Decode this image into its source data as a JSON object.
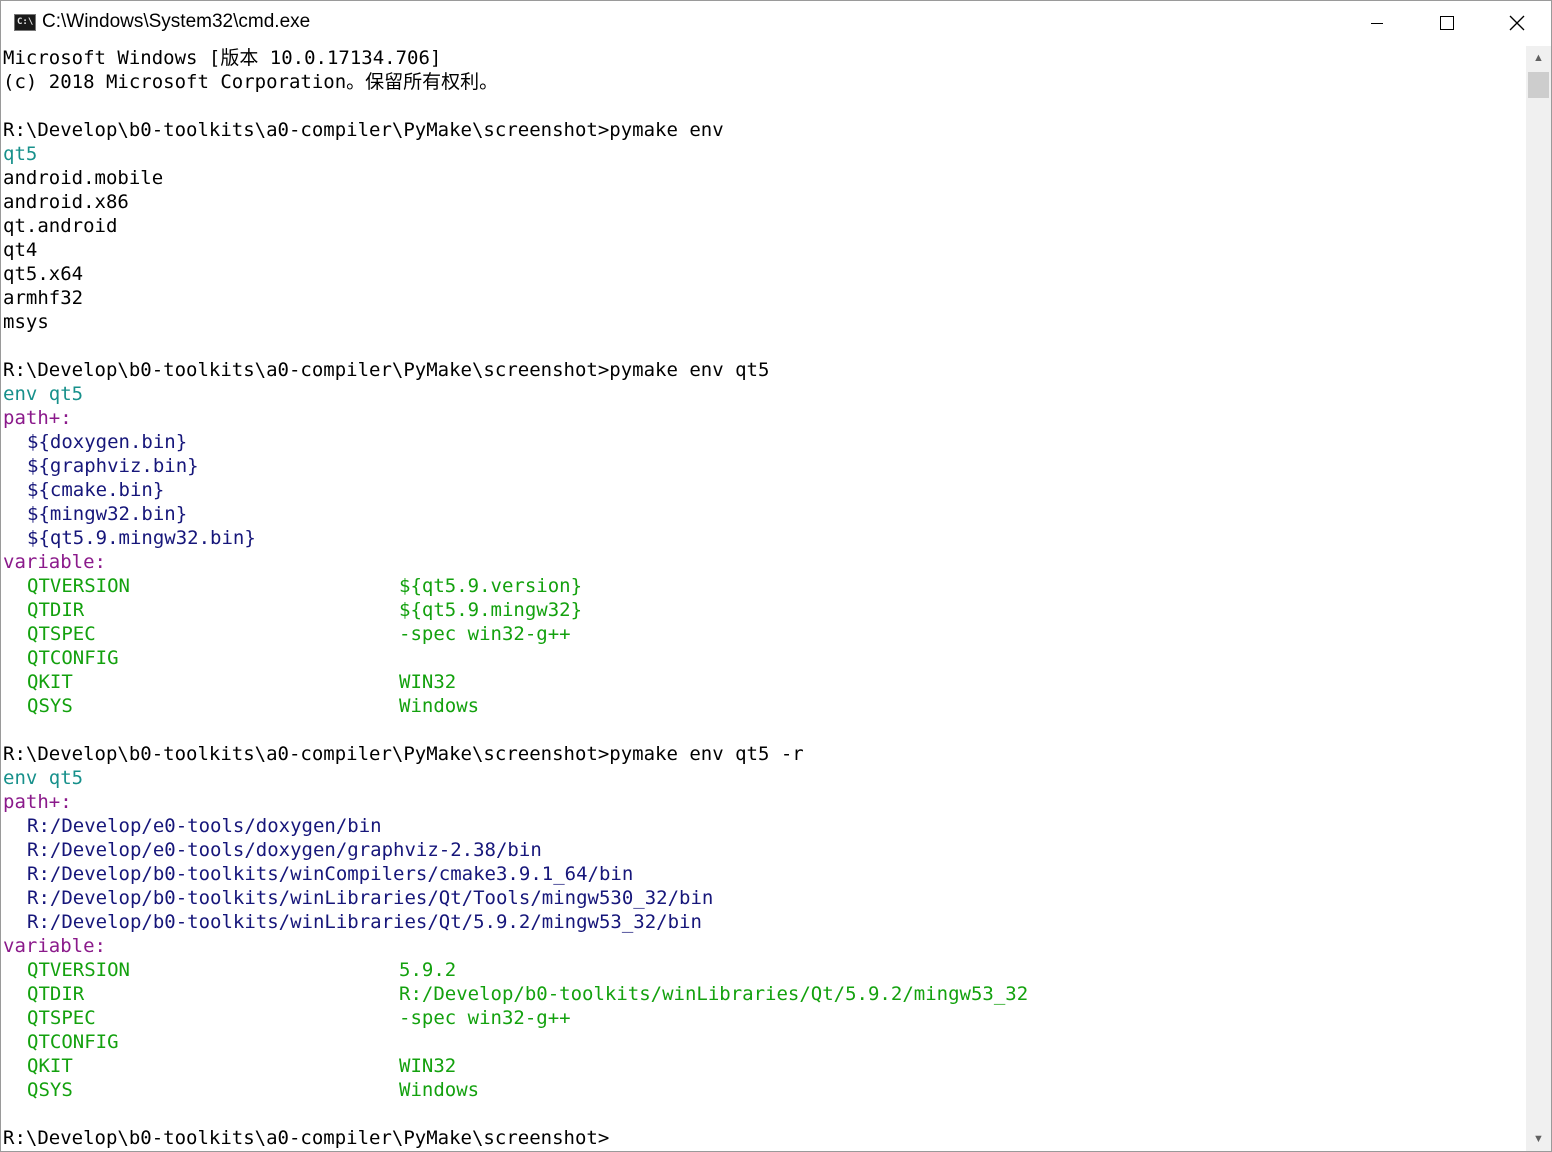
{
  "window": {
    "title": "C:\\Windows\\System32\\cmd.exe",
    "icon_text": "C:\\",
    "minimize_icon": "minimize-icon",
    "maximize_icon": "maximize-icon",
    "close_icon": "close-icon"
  },
  "colors": {
    "background": "#ffffff",
    "text": "#000000",
    "cyan": "#17908b",
    "magenta": "#8b1a8b",
    "green": "#13a10e",
    "blue": "#16167a"
  },
  "console": {
    "banner": {
      "line1": "Microsoft Windows [版本 10.0.17134.706]",
      "line2": "(c) 2018 Microsoft Corporation。保留所有权利。"
    },
    "block1": {
      "prompt": "R:\\Develop\\b0-toolkits\\a0-compiler\\PyMake\\screenshot>pymake env",
      "header": "qt5",
      "items": [
        "android.mobile",
        "android.x86",
        "qt.android",
        "qt4",
        "qt5.x64",
        "armhf32",
        "msys"
      ]
    },
    "block2": {
      "prompt": "R:\\Develop\\b0-toolkits\\a0-compiler\\PyMake\\screenshot>pymake env qt5",
      "env": "env qt5",
      "path_label": "path+:",
      "paths": [
        "${doxygen.bin}",
        "${graphviz.bin}",
        "${cmake.bin}",
        "${mingw32.bin}",
        "${qt5.9.mingw32.bin}"
      ],
      "variable_label": "variable:",
      "variables": [
        {
          "name": "QTVERSION",
          "value": "${qt5.9.version}"
        },
        {
          "name": "QTDIR",
          "value": "${qt5.9.mingw32}"
        },
        {
          "name": "QTSPEC",
          "value": "-spec win32-g++"
        },
        {
          "name": "QTCONFIG",
          "value": ""
        },
        {
          "name": "QKIT",
          "value": "WIN32"
        },
        {
          "name": "QSYS",
          "value": "Windows"
        }
      ]
    },
    "block3": {
      "prompt": "R:\\Develop\\b0-toolkits\\a0-compiler\\PyMake\\screenshot>pymake env qt5 -r",
      "env": "env qt5",
      "path_label": "path+:",
      "paths": [
        "R:/Develop/e0-tools/doxygen/bin",
        "R:/Develop/e0-tools/doxygen/graphviz-2.38/bin",
        "R:/Develop/b0-toolkits/winCompilers/cmake3.9.1_64/bin",
        "R:/Develop/b0-toolkits/winLibraries/Qt/Tools/mingw530_32/bin",
        "R:/Develop/b0-toolkits/winLibraries/Qt/5.9.2/mingw53_32/bin"
      ],
      "variable_label": "variable:",
      "variables": [
        {
          "name": "QTVERSION",
          "value": "5.9.2"
        },
        {
          "name": "QTDIR",
          "value": "R:/Develop/b0-toolkits/winLibraries/Qt/5.9.2/mingw53_32"
        },
        {
          "name": "QTSPEC",
          "value": "-spec win32-g++"
        },
        {
          "name": "QTCONFIG",
          "value": ""
        },
        {
          "name": "QKIT",
          "value": "WIN32"
        },
        {
          "name": "QSYS",
          "value": "Windows"
        }
      ]
    },
    "final_prompt": "R:\\Develop\\b0-toolkits\\a0-compiler\\PyMake\\screenshot>"
  },
  "scrollbar": {
    "up_icon": "scroll-up-arrow-icon",
    "down_icon": "scroll-down-arrow-icon",
    "position_fraction": 0.0
  }
}
